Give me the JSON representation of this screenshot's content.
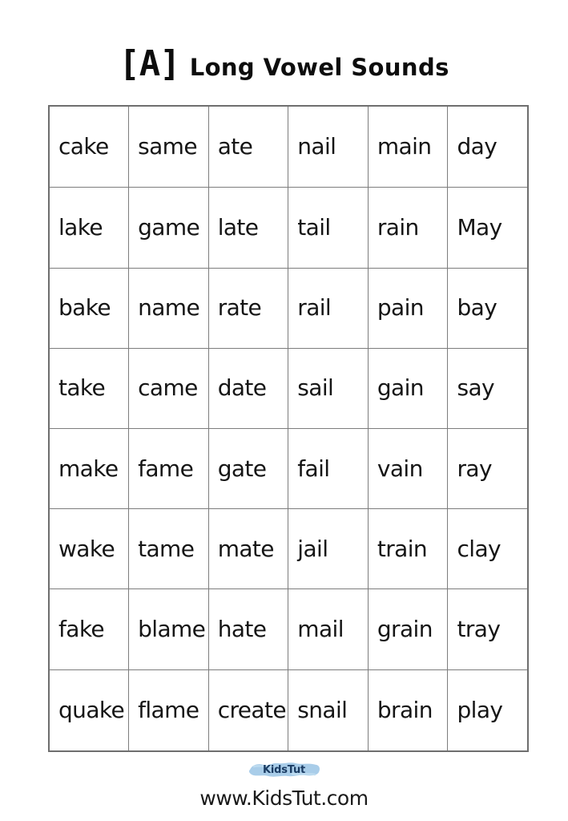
{
  "title": {
    "vowel_tag": "[A]",
    "heading": "Long Vowel Sounds"
  },
  "table": {
    "rows": [
      [
        "cake",
        "same",
        "ate",
        "nail",
        "main",
        "day"
      ],
      [
        "lake",
        "game",
        "late",
        "tail",
        "rain",
        "May"
      ],
      [
        "bake",
        "name",
        "rate",
        "rail",
        "pain",
        "bay"
      ],
      [
        "take",
        "came",
        "date",
        "sail",
        "gain",
        "say"
      ],
      [
        "make",
        "fame",
        "gate",
        "fail",
        "vain",
        "ray"
      ],
      [
        "wake",
        "tame",
        "mate",
        "jail",
        "train",
        "clay"
      ],
      [
        "fake",
        "blame",
        "hate",
        "mail",
        "grain",
        "tray"
      ],
      [
        "quake",
        "flame",
        "create",
        "snail",
        "brain",
        "play"
      ]
    ]
  },
  "footer": {
    "logo_text": "KidsTut",
    "site_url": "www.KidsTut.com",
    "logo_swoosh_color": "#a9cde9",
    "logo_text_color": "#1b3c63"
  },
  "colors": {
    "page_background": "#ffffff",
    "text": "#151515",
    "table_border": "#7d7d7d",
    "table_outer_border": "#6e6e6e"
  }
}
